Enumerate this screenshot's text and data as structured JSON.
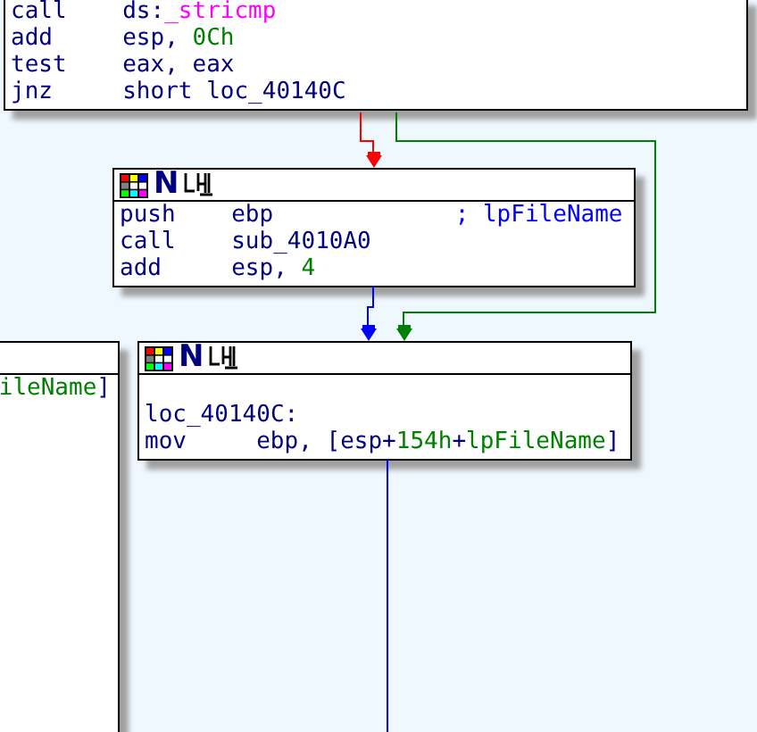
{
  "graph": {
    "nodes": [
      {
        "kind": "plain",
        "lines": [
          {
            "kind": "insn",
            "mnemonic": "call",
            "operands": [
              {
                "text": "ds:",
                "kind": "code"
              },
              {
                "text": "_stricmp",
                "kind": "import"
              }
            ]
          },
          {
            "kind": "insn",
            "mnemonic": "add",
            "operands": [
              {
                "text": "esp, ",
                "kind": "code"
              },
              {
                "text": "0Ch",
                "kind": "number"
              }
            ]
          },
          {
            "kind": "insn",
            "mnemonic": "test",
            "operands": [
              {
                "text": "eax, eax",
                "kind": "code"
              }
            ]
          },
          {
            "kind": "insn",
            "mnemonic": "jnz",
            "operands": [
              {
                "text": "short loc_40140C",
                "kind": "code"
              }
            ]
          }
        ]
      },
      {
        "kind": "titled",
        "mark": "N",
        "lines": [
          {
            "kind": "insn",
            "mnemonic": "push",
            "operands": [
              {
                "text": "ebp",
                "kind": "code"
              }
            ],
            "comment": "; lpFileName"
          },
          {
            "kind": "insn",
            "mnemonic": "call",
            "operands": [
              {
                "text": "sub_4010A0",
                "kind": "code"
              }
            ]
          },
          {
            "kind": "insn",
            "mnemonic": "add",
            "operands": [
              {
                "text": "esp, ",
                "kind": "code"
              },
              {
                "text": "4",
                "kind": "number"
              }
            ]
          }
        ]
      },
      {
        "kind": "untitled",
        "lines": [
          {
            "kind": "fragment",
            "operands": [
              {
                "text": "ileName",
                "kind": "stackvar"
              },
              {
                "text": "]",
                "kind": "code"
              }
            ]
          }
        ]
      },
      {
        "kind": "titled",
        "mark": "N",
        "lines": [
          {
            "kind": "blank"
          },
          {
            "kind": "label",
            "label": "loc_40140C:"
          },
          {
            "kind": "insn",
            "mnemonic": "mov",
            "operands": [
              {
                "text": "ebp, [esp+",
                "kind": "code"
              },
              {
                "text": "154h",
                "kind": "number"
              },
              {
                "text": "+",
                "kind": "code"
              },
              {
                "text": "lpFileName",
                "kind": "stackvar"
              },
              {
                "text": "]",
                "kind": "code"
              }
            ]
          }
        ]
      }
    ],
    "edges": [
      {
        "color": "#ff0000"
      },
      {
        "color": "#008000"
      },
      {
        "color": "#0000ff"
      },
      {
        "color": "#0000ff"
      }
    ]
  }
}
